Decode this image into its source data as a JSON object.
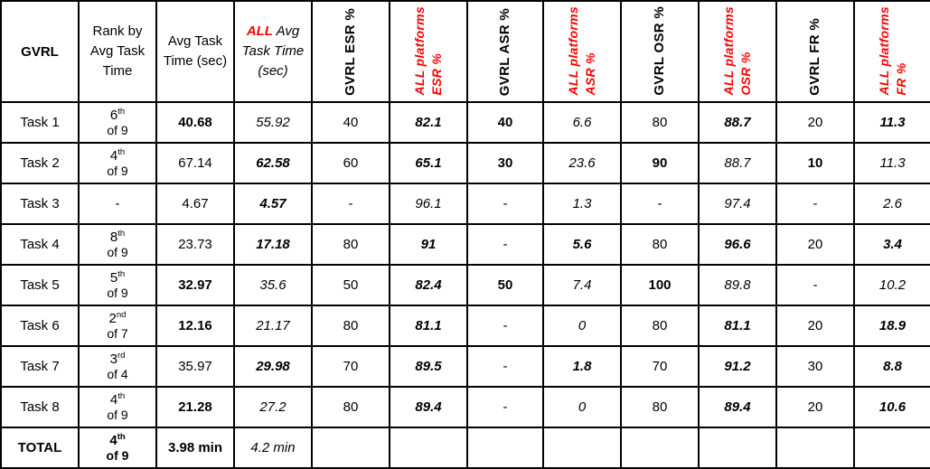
{
  "table": {
    "corner_label": "GVRL",
    "headers": [
      {
        "id": "task",
        "label": "",
        "type": "blank"
      },
      {
        "id": "rank",
        "label": "Rank by Avg Task Time",
        "type": "text"
      },
      {
        "id": "avg_task_time",
        "label": "Avg Task Time (sec)",
        "type": "text"
      },
      {
        "id": "all_avg_task_time",
        "label_prefix": "ALL",
        "label": "Avg Task Time (sec)",
        "type": "text-italic-red"
      },
      {
        "id": "gvrl_esr",
        "label_line1": "GVRL ESR %",
        "type": "vertical",
        "fill": "lightgreen"
      },
      {
        "id": "all_esr",
        "label_line1": "ALL platforms",
        "label_line2": "ESR %",
        "type": "vertical-red",
        "fill": "white"
      },
      {
        "id": "gvrl_asr",
        "label_line1": "GVRL ASR %",
        "type": "vertical",
        "fill": "lightgreen"
      },
      {
        "id": "all_asr",
        "label_line1": "ALL platforms",
        "label_line2": "ASR %",
        "type": "vertical-red",
        "fill": "white"
      },
      {
        "id": "gvrl_osr",
        "label_line1": "GVRL OSR %",
        "type": "vertical",
        "fill": "midgreen"
      },
      {
        "id": "all_osr",
        "label_line1": "ALL platforms",
        "label_line2": "OSR %",
        "type": "vertical-red",
        "fill": "white"
      },
      {
        "id": "gvrl_fr",
        "label_line1": "GVRL FR %",
        "type": "vertical",
        "fill": "peach"
      },
      {
        "id": "all_fr",
        "label_line1": "ALL platforms",
        "label_line2": "FR %",
        "type": "vertical-red",
        "fill": "white"
      }
    ],
    "rows": [
      {
        "task": "Task 1",
        "rank": {
          "ordinal": "6",
          "suffix": "th",
          "of": "of 9",
          "bold": false
        },
        "avg_task_time": "40.68",
        "avg_task_time_style": "b",
        "all_avg_task_time": "55.92",
        "all_avg_task_time_style": "i",
        "gvrl_esr": "40",
        "gvrl_esr_style": "",
        "all_esr": "82.1",
        "all_esr_style": "bi",
        "gvrl_asr": "40",
        "gvrl_asr_style": "b",
        "all_asr": "6.6",
        "all_asr_style": "i",
        "gvrl_osr": "80",
        "gvrl_osr_style": "",
        "all_osr": "88.7",
        "all_osr_style": "bi",
        "gvrl_fr": "20",
        "gvrl_fr_style": "",
        "all_fr": "11.3",
        "all_fr_style": "bi"
      },
      {
        "task": "Task 2",
        "rank": {
          "ordinal": "4",
          "suffix": "th",
          "of": "of 9",
          "bold": false
        },
        "avg_task_time": "67.14",
        "avg_task_time_style": "",
        "all_avg_task_time": "62.58",
        "all_avg_task_time_style": "bi",
        "gvrl_esr": "60",
        "gvrl_esr_style": "",
        "all_esr": "65.1",
        "all_esr_style": "bi",
        "gvrl_asr": "30",
        "gvrl_asr_style": "b",
        "all_asr": "23.6",
        "all_asr_style": "i",
        "gvrl_osr": "90",
        "gvrl_osr_style": "b",
        "all_osr": "88.7",
        "all_osr_style": "i",
        "gvrl_fr": "10",
        "gvrl_fr_style": "b",
        "all_fr": "11.3",
        "all_fr_style": "i"
      },
      {
        "task": "Task 3",
        "rank": {
          "dash": "-"
        },
        "avg_task_time": "4.67",
        "avg_task_time_style": "",
        "all_avg_task_time": "4.57",
        "all_avg_task_time_style": "bi",
        "gvrl_esr": "-",
        "gvrl_esr_style": "",
        "all_esr": "96.1",
        "all_esr_style": "i",
        "gvrl_asr": "-",
        "gvrl_asr_style": "",
        "all_asr": "1.3",
        "all_asr_style": "i",
        "gvrl_osr": "-",
        "gvrl_osr_style": "",
        "all_osr": "97.4",
        "all_osr_style": "i",
        "gvrl_fr": "-",
        "gvrl_fr_style": "",
        "all_fr": "2.6",
        "all_fr_style": "i"
      },
      {
        "task": "Task 4",
        "rank": {
          "ordinal": "8",
          "suffix": "th",
          "of": "of 9",
          "bold": false
        },
        "avg_task_time": "23.73",
        "avg_task_time_style": "",
        "all_avg_task_time": "17.18",
        "all_avg_task_time_style": "bi",
        "gvrl_esr": "80",
        "gvrl_esr_style": "",
        "all_esr": "91",
        "all_esr_style": "bi",
        "gvrl_asr": "-",
        "gvrl_asr_style": "",
        "all_asr": "5.6",
        "all_asr_style": "bi",
        "gvrl_osr": "80",
        "gvrl_osr_style": "",
        "all_osr": "96.6",
        "all_osr_style": "bi",
        "gvrl_fr": "20",
        "gvrl_fr_style": "",
        "all_fr": "3.4",
        "all_fr_style": "bi"
      },
      {
        "task": "Task 5",
        "rank": {
          "ordinal": "5",
          "suffix": "th",
          "of": "of 9",
          "bold": false
        },
        "avg_task_time": "32.97",
        "avg_task_time_style": "b",
        "all_avg_task_time": "35.6",
        "all_avg_task_time_style": "i",
        "gvrl_esr": "50",
        "gvrl_esr_style": "",
        "all_esr": "82.4",
        "all_esr_style": "bi",
        "gvrl_asr": "50",
        "gvrl_asr_style": "b",
        "all_asr": "7.4",
        "all_asr_style": "i",
        "gvrl_osr": "100",
        "gvrl_osr_style": "b",
        "all_osr": "89.8",
        "all_osr_style": "i",
        "gvrl_fr": "-",
        "gvrl_fr_style": "",
        "all_fr": "10.2",
        "all_fr_style": "i"
      },
      {
        "task": "Task 6",
        "rank": {
          "ordinal": "2",
          "suffix": "nd",
          "of": "of 7",
          "bold": false
        },
        "avg_task_time": "12.16",
        "avg_task_time_style": "b",
        "all_avg_task_time": "21.17",
        "all_avg_task_time_style": "i",
        "gvrl_esr": "80",
        "gvrl_esr_style": "",
        "all_esr": "81.1",
        "all_esr_style": "bi",
        "gvrl_asr": "-",
        "gvrl_asr_style": "",
        "all_asr": "0",
        "all_asr_style": "i",
        "gvrl_osr": "80",
        "gvrl_osr_style": "",
        "all_osr": "81.1",
        "all_osr_style": "bi",
        "gvrl_fr": "20",
        "gvrl_fr_style": "",
        "all_fr": "18.9",
        "all_fr_style": "bi"
      },
      {
        "task": "Task 7",
        "rank": {
          "ordinal": "3",
          "suffix": "rd",
          "of": "of 4",
          "bold": false
        },
        "avg_task_time": "35.97",
        "avg_task_time_style": "",
        "all_avg_task_time": "29.98",
        "all_avg_task_time_style": "bi",
        "gvrl_esr": "70",
        "gvrl_esr_style": "",
        "all_esr": "89.5",
        "all_esr_style": "bi",
        "gvrl_asr": "-",
        "gvrl_asr_style": "",
        "all_asr": "1.8",
        "all_asr_style": "bi",
        "gvrl_osr": "70",
        "gvrl_osr_style": "",
        "all_osr": "91.2",
        "all_osr_style": "bi",
        "gvrl_fr": "30",
        "gvrl_fr_style": "",
        "all_fr": "8.8",
        "all_fr_style": "bi"
      },
      {
        "task": "Task 8",
        "rank": {
          "ordinal": "4",
          "suffix": "th",
          "of": "of 9",
          "bold": false
        },
        "avg_task_time": "21.28",
        "avg_task_time_style": "b",
        "all_avg_task_time": "27.2",
        "all_avg_task_time_style": "i",
        "gvrl_esr": "80",
        "gvrl_esr_style": "",
        "all_esr": "89.4",
        "all_esr_style": "bi",
        "gvrl_asr": "-",
        "gvrl_asr_style": "",
        "all_asr": "0",
        "all_asr_style": "i",
        "gvrl_osr": "80",
        "gvrl_osr_style": "",
        "all_osr": "89.4",
        "all_osr_style": "bi",
        "gvrl_fr": "20",
        "gvrl_fr_style": "",
        "all_fr": "10.6",
        "all_fr_style": "bi"
      }
    ],
    "total_row": {
      "task": "TOTAL",
      "rank": {
        "ordinal": "4",
        "suffix": "th",
        "of": "of 9",
        "bold": true
      },
      "avg_task_time": "3.98 min",
      "avg_task_time_style": "b",
      "all_avg_task_time": "4.2 min",
      "all_avg_task_time_style": "i",
      "gvrl_esr": "",
      "all_esr": "",
      "gvrl_asr": "",
      "all_asr": "",
      "gvrl_osr": "",
      "all_osr": "",
      "gvrl_fr": "",
      "all_fr": ""
    }
  },
  "colors": {
    "light_green": "#E2EFDA",
    "mid_green": "#A9D08E",
    "peach": "#F8CBAD",
    "grey": "#A6A6A6",
    "red_accent": "#FF0000",
    "black": "#000000",
    "white": "#FFFFFF"
  }
}
